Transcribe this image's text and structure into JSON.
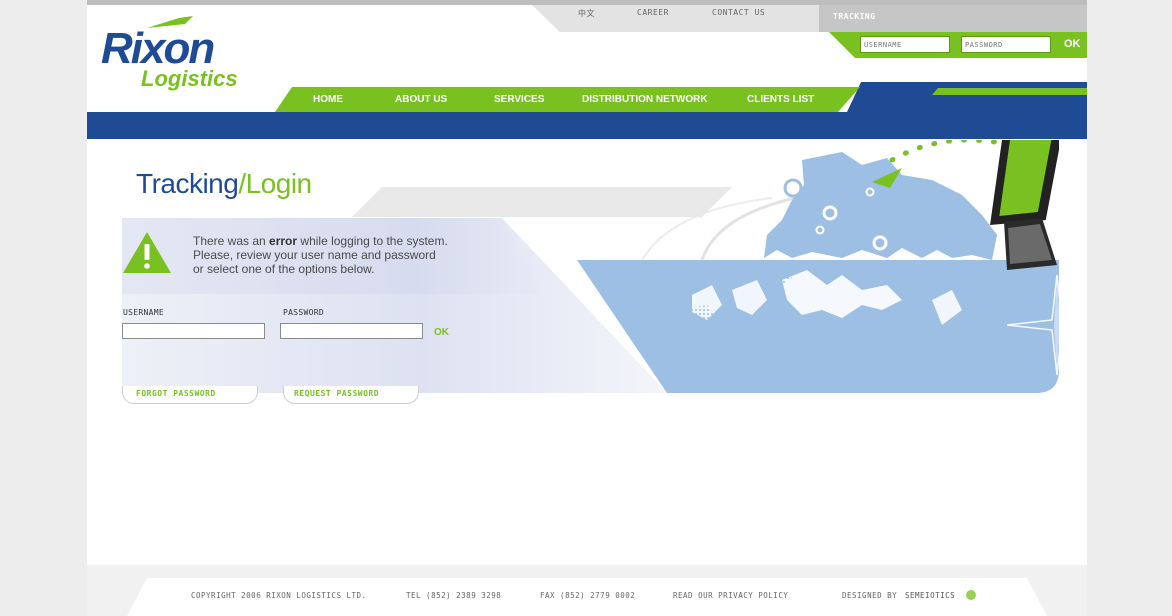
{
  "top_links": {
    "chinese": "中文",
    "career": "CAREER",
    "contact": "CONTACT US"
  },
  "tracking_label": "TRACKING",
  "top_login": {
    "username_placeholder": "USERNAME",
    "password_placeholder": "PASSWORD",
    "ok": "OK"
  },
  "logo": {
    "line1": "Rixon",
    "line2": "Logistics"
  },
  "nav": {
    "items": [
      "HOME",
      "ABOUT US",
      "SERVICES",
      "DISTRIBUTION NETWORK",
      "CLIENTS LIST"
    ]
  },
  "page_title": {
    "part1": "Tracking",
    "separator": "/",
    "part2": "Login"
  },
  "error": {
    "prefix": "There was an ",
    "keyword": "error",
    "suffix": " while logging to the system.",
    "line2": "Please, review  your user name and password",
    "line3": "or select one of the options below."
  },
  "form": {
    "username_label": "USERNAME",
    "password_label": "PASSWORD",
    "ok": "OK",
    "forgot": "FORGOT PASSWORD",
    "request": "REQUEST PASSWORD"
  },
  "footer": {
    "copyright": "COPYRIGHT  2006 RIXON LOGISTICS LTD.",
    "tel": "TEL (852) 2389 3298",
    "fax": "FAX (852) 2779 0002",
    "privacy": "READ OUR PRIVACY POLICY",
    "designed_by": "DESIGNED BY",
    "designer": "SEMEIOTICS"
  },
  "colors": {
    "brand_blue": "#1f4b95",
    "brand_green": "#78c120",
    "map_blue": "#9dbfe3"
  }
}
